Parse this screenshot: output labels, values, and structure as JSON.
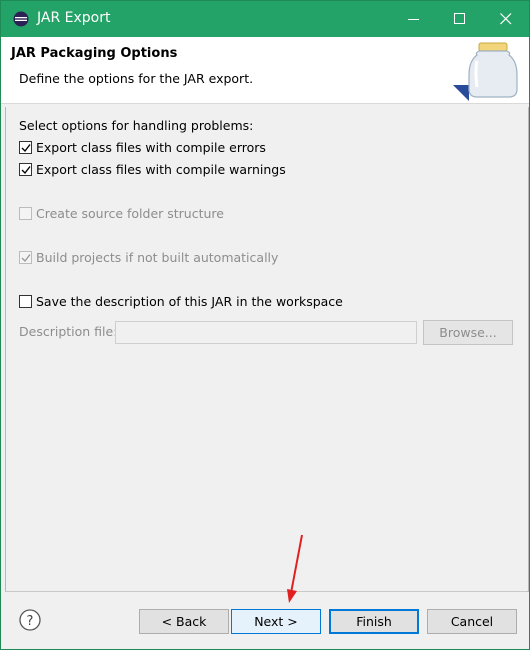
{
  "window": {
    "title": "JAR Export"
  },
  "header": {
    "title": "JAR Packaging Options",
    "description": "Define the options for the JAR export."
  },
  "options": {
    "section_label": "Select options for handling problems:",
    "export_errors": {
      "label": "Export class files with compile errors",
      "checked": true
    },
    "export_warnings": {
      "label": "Export class files with compile warnings",
      "checked": true
    },
    "create_source_folder": {
      "label": "Create source folder structure",
      "checked": false,
      "enabled": false
    },
    "build_projects": {
      "label": "Build projects if not built automatically",
      "checked": true,
      "enabled": false
    },
    "save_description": {
      "label": "Save the description of this JAR in the workspace",
      "checked": false
    }
  },
  "description_file": {
    "label": "Description file:",
    "value": "",
    "browse_label": "Browse..."
  },
  "footer": {
    "back_label": "< Back",
    "next_label": "Next >",
    "finish_label": "Finish",
    "cancel_label": "Cancel"
  },
  "colors": {
    "titlebar": "#24a368",
    "accent": "#0078d7",
    "annotation_arrow": "#e02020"
  }
}
